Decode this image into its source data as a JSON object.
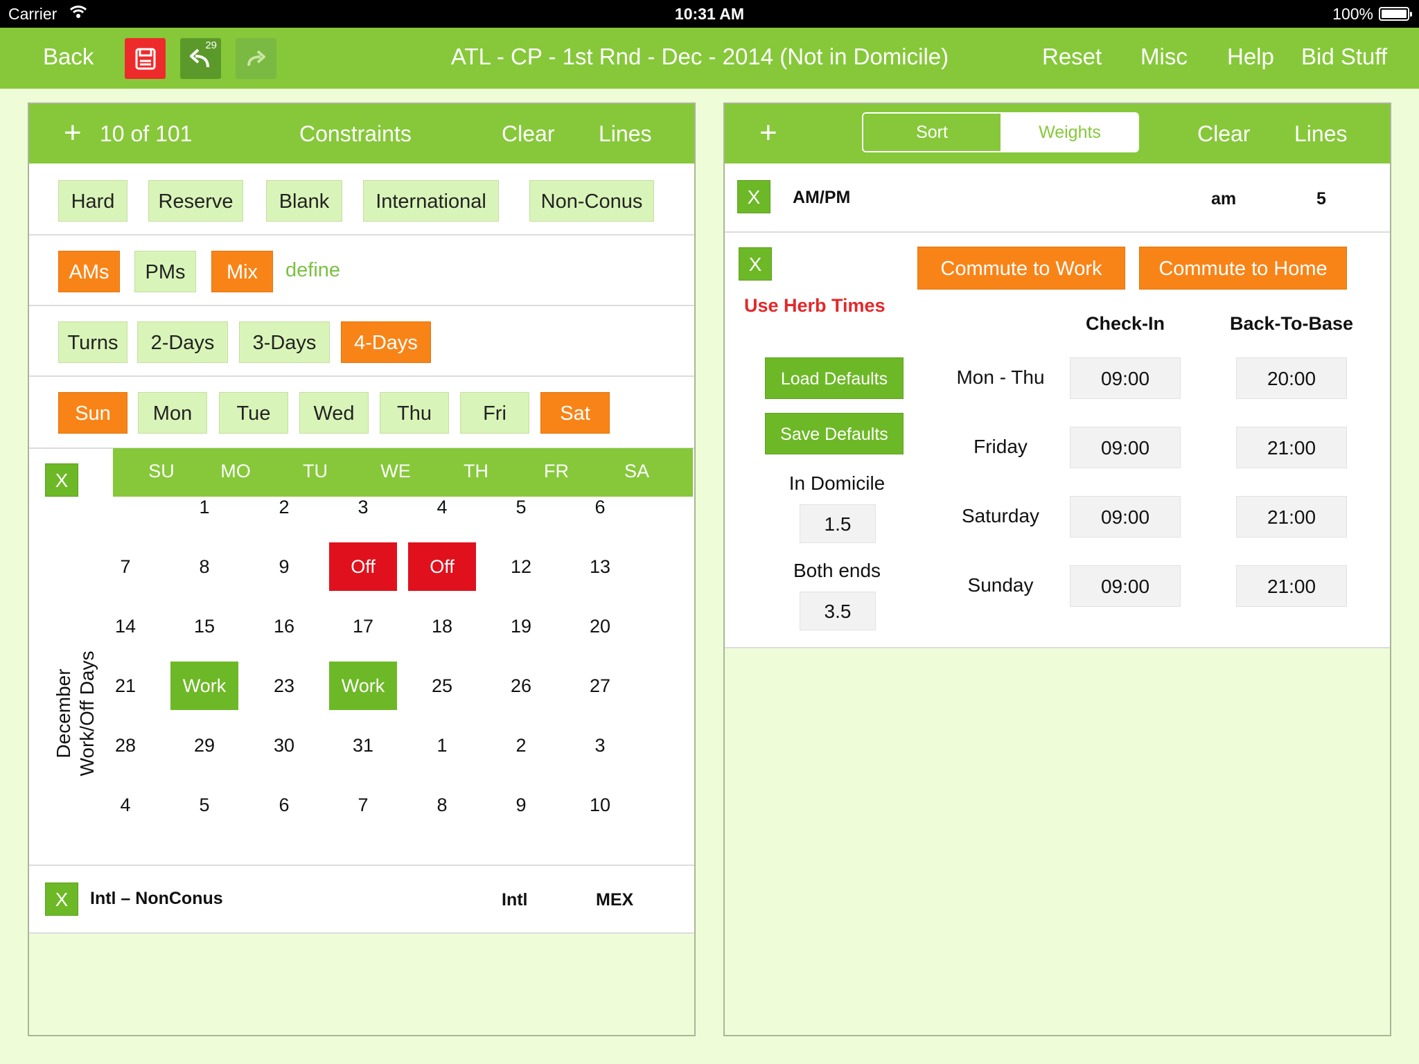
{
  "status": {
    "carrier": "Carrier",
    "time": "10:31 AM",
    "battery": "100%"
  },
  "nav": {
    "back": "Back",
    "undo_count": "29",
    "title": "ATL - CP - 1st Rnd - Dec - 2014 (Not in Domicile)",
    "reset": "Reset",
    "misc": "Misc",
    "help": "Help",
    "bid_stuff": "Bid Stuff",
    "colors": {
      "bar": "#86c83a",
      "save": "#ee2b2b",
      "undo": "#5b9a2a"
    }
  },
  "left": {
    "header": {
      "count": "10 of 101",
      "title": "Constraints",
      "clear": "Clear",
      "lines": "Lines"
    },
    "row1": [
      "Hard",
      "Reserve",
      "Blank",
      "International",
      "Non-Conus"
    ],
    "row2": {
      "items": [
        "AMs",
        "PMs",
        "Mix"
      ],
      "selected": [
        "AMs",
        "Mix"
      ],
      "define": "define"
    },
    "row3": {
      "items": [
        "Turns",
        "2-Days",
        "3-Days",
        "4-Days"
      ],
      "selected": [
        "4-Days"
      ]
    },
    "row4": {
      "items": [
        "Sun",
        "Mon",
        "Tue",
        "Wed",
        "Thu",
        "Fri",
        "Sat"
      ],
      "selected": [
        "Sun",
        "Sat"
      ]
    },
    "calendar": {
      "x": "X",
      "side_label_1": "December",
      "side_label_2": "Work/Off Days",
      "days_of_week": [
        "SU",
        "MO",
        "TU",
        "WE",
        "TH",
        "FR",
        "SA"
      ],
      "weeks": [
        [
          "",
          "1",
          "2",
          "3",
          "4",
          "5",
          "6"
        ],
        [
          "7",
          "8",
          "9",
          "Off",
          "Off",
          "12",
          "13"
        ],
        [
          "14",
          "15",
          "16",
          "17",
          "18",
          "19",
          "20"
        ],
        [
          "21",
          "Work",
          "23",
          "Work",
          "25",
          "26",
          "27"
        ],
        [
          "28",
          "29",
          "30",
          "31",
          "1",
          "2",
          "3"
        ],
        [
          "4",
          "5",
          "6",
          "7",
          "8",
          "9",
          "10"
        ]
      ]
    },
    "intl": {
      "x": "X",
      "label": "Intl – NonConus",
      "type": "Intl",
      "country": "MEX"
    }
  },
  "right": {
    "header": {
      "sort": "Sort",
      "weights": "Weights",
      "clear": "Clear",
      "lines": "Lines"
    },
    "ampm": {
      "x": "X",
      "label": "AM/PM",
      "value": "am",
      "weight": "5"
    },
    "commute": {
      "x": "X",
      "to_work": "Commute to Work",
      "to_home": "Commute to Home",
      "herb": "Use Herb Times",
      "col_checkin": "Check-In",
      "col_back": "Back-To-Base",
      "load": "Load Defaults",
      "save": "Save Defaults",
      "in_domicile_label": "In Domicile",
      "in_domicile": "1.5",
      "both_ends_label": "Both ends",
      "both_ends": "3.5",
      "rows": [
        {
          "day": "Mon - Thu",
          "checkin": "09:00",
          "back": "20:00"
        },
        {
          "day": "Friday",
          "checkin": "09:00",
          "back": "21:00"
        },
        {
          "day": "Saturday",
          "checkin": "09:00",
          "back": "21:00"
        },
        {
          "day": "Sunday",
          "checkin": "09:00",
          "back": "21:00"
        }
      ]
    }
  }
}
